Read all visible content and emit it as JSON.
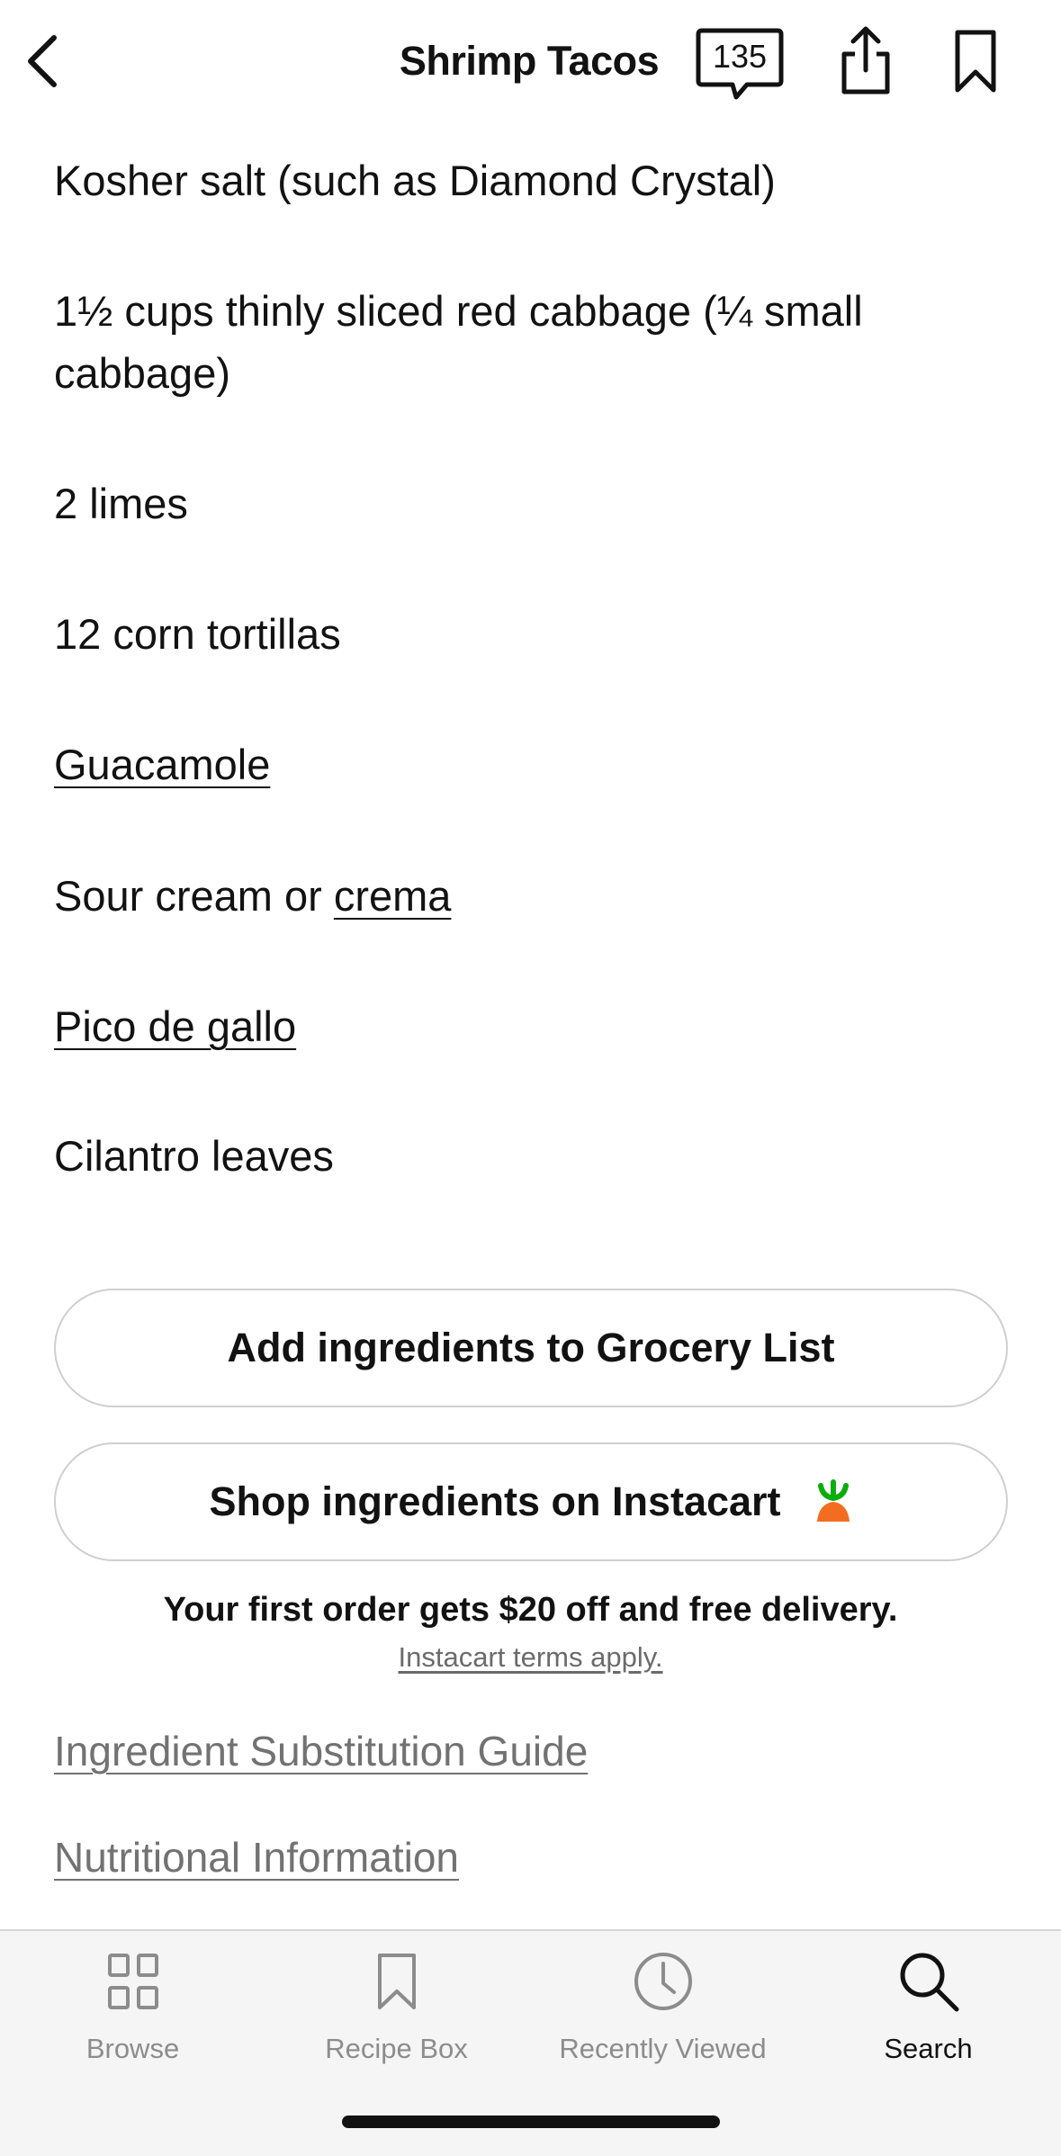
{
  "header": {
    "title": "Shrimp Tacos",
    "comment_count": "135",
    "icons": [
      "back-chevron-icon",
      "comment-icon",
      "share-icon",
      "bookmark-icon"
    ]
  },
  "ingredients": [
    {
      "text": "Kosher salt (such as Diamond Crystal)"
    },
    {
      "text": "1½ cups thinly sliced red cabbage (¼ small cabbage)"
    },
    {
      "text": "2 limes"
    },
    {
      "text": "12 corn tortillas"
    },
    {
      "text": "Guacamole",
      "link": true
    },
    {
      "prefix": "Sour cream or ",
      "link_text": "crema"
    },
    {
      "text": "Pico de gallo",
      "link": true
    },
    {
      "text": "Cilantro leaves"
    }
  ],
  "actions": {
    "grocery_label": "Add ingredients to Grocery List",
    "instacart_label": "Shop ingredients on Instacart",
    "instacart_icon": "carrot-icon",
    "promo_text": "Your first order gets $20 off and free delivery.",
    "terms_text": "Instacart terms apply."
  },
  "links": {
    "substitution": "Ingredient Substitution Guide",
    "nutrition": "Nutritional Information"
  },
  "tabbar": {
    "tabs": [
      {
        "label": "Browse",
        "icon": "grid-icon",
        "active": false
      },
      {
        "label": "Recipe Box",
        "icon": "bookmark-icon",
        "active": false
      },
      {
        "label": "Recently Viewed",
        "icon": "clock-icon",
        "active": false
      },
      {
        "label": "Search",
        "icon": "search-icon",
        "active": true
      }
    ]
  },
  "colors": {
    "text": "#121212",
    "muted": "#727272",
    "border": "#cfcfcf",
    "tabbar_bg": "#f5f5f5",
    "carrot_orange": "#f36d21",
    "carrot_green": "#0aad0a"
  }
}
